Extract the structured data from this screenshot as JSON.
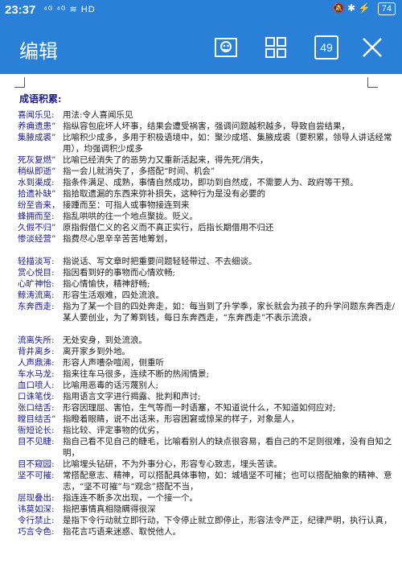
{
  "status": {
    "time": "23:37",
    "left_icons": "⁴ᴳ ⁴ᴳ ≋ HD",
    "right_icons": "🔕 ✱ ⚡",
    "battery": "74"
  },
  "appbar": {
    "title": "编辑",
    "page_number": "49"
  },
  "doc": {
    "heading": "成语积累:",
    "entries": [
      {
        "term": "喜闻乐见:",
        "def": "用法:令人喜闻乐见"
      },
      {
        "term": "养痈遗患”",
        "def": "指纵容包庇坏人坏事，结果会遭受祸害，强调问题越积越多，导致自尝结果，"
      },
      {
        "term": "集腋成裘”",
        "def": "比喻积少成多，多用于积极语境中，如：聚沙成塔、集腋成裘（要积累，领导人讲话经常用），均强调积少成多"
      },
      {
        "term": "死灰复燃”",
        "def": "比喻已经消失了的恶势力又重新活起来，得先死/消失，"
      },
      {
        "term": "稍纵即逝”",
        "def": "指一会儿就消失了，多搭配“时间、机会”"
      },
      {
        "term": "水到渠成:",
        "def": "指条件满足、成熟，事情自然成功，即功到自然成，不需要人为、政府等干预。"
      },
      {
        "term": "拾遗补缺”",
        "def": "指拾取遗漏的东西来弥补损失，这种行为是没有必要的"
      },
      {
        "term": "纷至沓来，",
        "def": "接踵而至：可指人或事物接连到来"
      },
      {
        "term": "蜂拥而至:",
        "def": "指乱哄哄的往一个地点聚拢。贬义。"
      },
      {
        "term": "久假不归”",
        "def": "原指假借仁义的名义而不真正实行，后指长期借用不归还"
      },
      {
        "term": "惨淡经营”",
        "def": "指费尽心思辛辛苦苦地筹划，"
      },
      {
        "term": "轻描淡写:",
        "def": "指说话、写文章时把重要问题轻轻带过、不去细谈。"
      },
      {
        "term": "赏心悦目:",
        "def": "指因看到好的事物而心情欢畅;"
      },
      {
        "term": "心旷神怡:",
        "def": "指心情愉快，精神舒畅;"
      },
      {
        "term": "鲸涛流离:",
        "def": "形容生活艰难，四处流浪。"
      },
      {
        "term": "东奔西走:",
        "def": "指为了某一个目的四处奔走，如：每当到了升学季，家长就会为孩子的升学问题东奔西走/某人要创业，为了筹到钱，每日东奔西走，“东奔西走”不表示流浪，"
      },
      {
        "term": "流离失所:",
        "def": "无处安身，到处流浪。"
      },
      {
        "term": "背井离乡:",
        "def": "离开家乡到外地。"
      },
      {
        "term": "人声鼎沸:",
        "def": "形容人声嘈杂喧闹，侧重听"
      },
      {
        "term": "车水马龙:",
        "def": "指来往车马很多，连续不断的热闹情景;"
      },
      {
        "term": "血口喷人:",
        "def": "比喻用恶毒的话污蔑别人;"
      },
      {
        "term": "口诛笔伐:",
        "def": "指用语言文字进行揭露、批判和声讨;"
      },
      {
        "term": "张口结舌:",
        "def": "形容因理屈、害怕，生气等而一时语塞，不知道说什么，不知道如何应对;"
      },
      {
        "term": "瞠目结舌”",
        "def": "指瞪着眼睛，说不出话来，形容困窘或惊呆的样子，对象是人，"
      },
      {
        "term": "衙短论长:",
        "def": "指比较、评定事物的优劣，"
      },
      {
        "term": "目不见睫:",
        "def": "指自己看不见自己的睫毛，比喻看别人的缺点很容易，看自己的不足则很难，没有自知之明，"
      },
      {
        "term": "目不窥园:",
        "def": "比喻埋头钻研，不为外事分心，形容专心致志，埋头苦读。"
      },
      {
        "term": "坚不可摧:",
        "def": "常搭配意志、精神，可以搭配具体事物，如：城墙坚不可摧；也可以搭配抽象的精神、意志，“坚不可摧”与“观念”搭配不当，"
      },
      {
        "term": "层现叠出:",
        "def": "指连连不断多次出现，一个接一个。"
      },
      {
        "term": "讳莫如深:",
        "def": "指把事情真相隐瞒得很深"
      },
      {
        "term": "令行禁止:",
        "def": "是指下令行动就立即行动，下令停止就立即停止，形容法令严正，纪律严明，执行认真，"
      },
      {
        "term": "巧言令色:",
        "def": "指花言巧语来迷惑、取悦他人。"
      }
    ]
  }
}
